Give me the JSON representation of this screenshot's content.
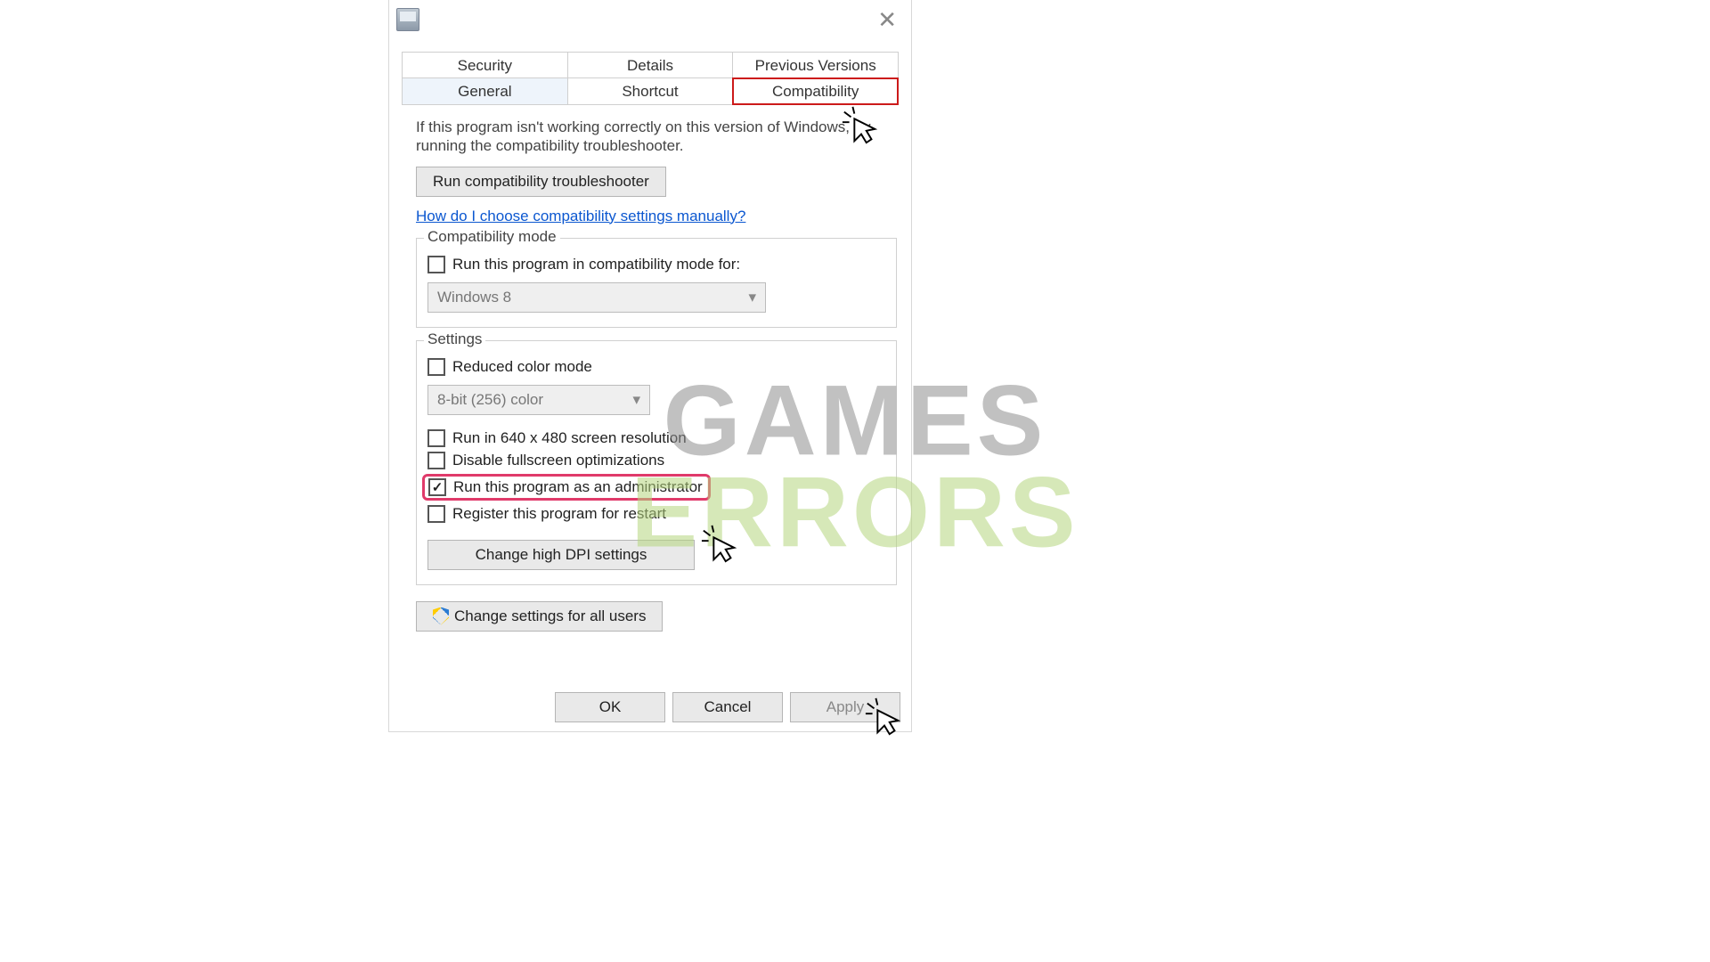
{
  "tabs_top": [
    "Security",
    "Details",
    "Previous Versions"
  ],
  "tabs_bottom": [
    "General",
    "Shortcut",
    "Compatibility"
  ],
  "intro": "If this program isn't working correctly on this version of Windows, try running the compatibility troubleshooter.",
  "btn_troubleshooter": "Run compatibility troubleshooter",
  "link_manual": "How do I choose compatibility settings manually?",
  "compat_mode": {
    "legend": "Compatibility mode",
    "label": "Run this program in compatibility mode for:",
    "value": "Windows 8"
  },
  "settings": {
    "legend": "Settings",
    "reduced_color": "Reduced color mode",
    "color_value": "8-bit (256) color",
    "resolution": "Run in 640 x 480 screen resolution",
    "disable_fs": "Disable fullscreen optimizations",
    "run_admin": "Run this program as an administrator",
    "register_restart": "Register this program for restart",
    "dpi_btn": "Change high DPI settings"
  },
  "btn_all_users": "Change settings for all users",
  "footer": {
    "ok": "OK",
    "cancel": "Cancel",
    "apply": "Apply"
  },
  "watermark": {
    "line1": "GAMES",
    "line2": "ERRORS"
  }
}
